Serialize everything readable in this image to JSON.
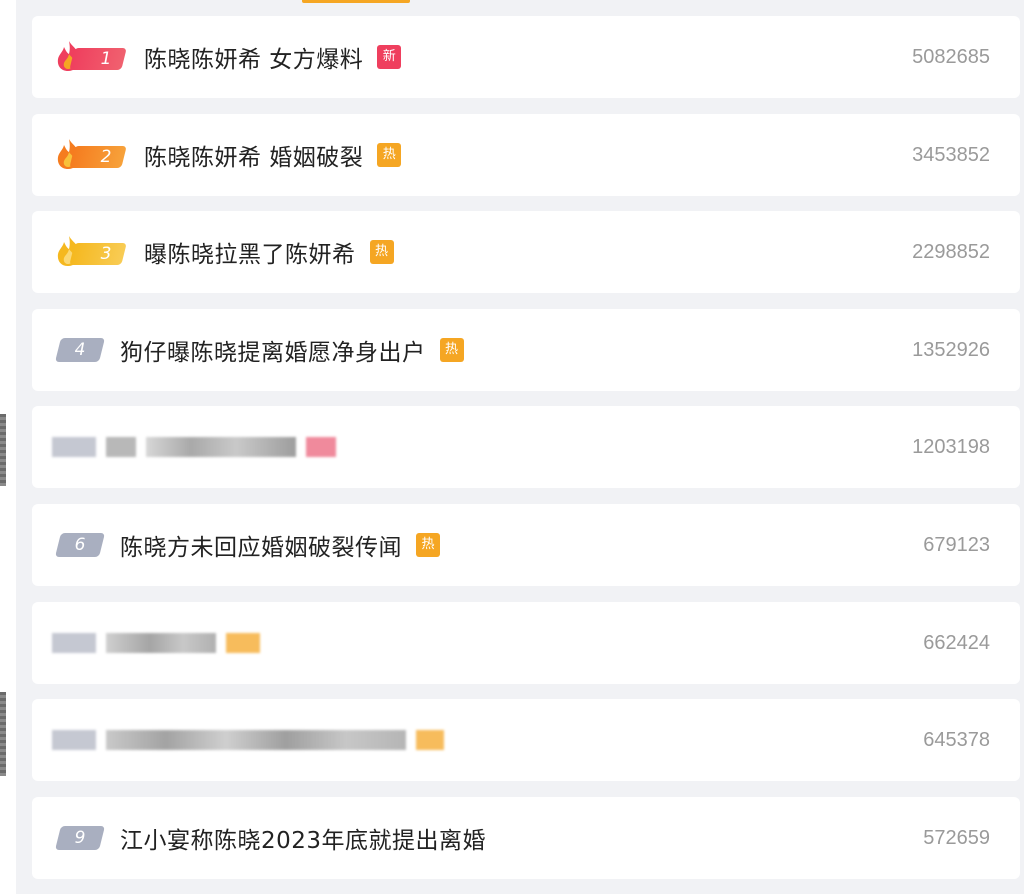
{
  "colors": {
    "rank1": "#ef3f5e",
    "rank2": "#f57c1f",
    "rank3": "#f5b81f",
    "rank_gray": "#a9afc0",
    "tag_new": "#ef3f5e",
    "tag_hot": "#f5a623",
    "count_text": "#9a9a9a"
  },
  "rows": [
    {
      "rank": "1",
      "title": "陈晓陈妍希 女方爆料",
      "tag": "新",
      "tag_type": "new",
      "count": "5082685",
      "icon": "flame-icon"
    },
    {
      "rank": "2",
      "title": "陈晓陈妍希 婚姻破裂",
      "tag": "热",
      "tag_type": "hot",
      "count": "3453852",
      "icon": "flame-icon"
    },
    {
      "rank": "3",
      "title": "曝陈晓拉黑了陈妍希",
      "tag": "热",
      "tag_type": "hot",
      "count": "2298852",
      "icon": "flame-icon"
    },
    {
      "rank": "4",
      "title": "狗仔曝陈晓提离婚愿净身出户",
      "tag": "热",
      "tag_type": "hot",
      "count": "1352926"
    },
    {
      "count": "1203198",
      "blurred": true
    },
    {
      "rank": "6",
      "title": "陈晓方未回应婚姻破裂传闻",
      "tag": "热",
      "tag_type": "hot",
      "count": "679123"
    },
    {
      "count": "662424",
      "blurred": true
    },
    {
      "count": "645378",
      "blurred": true
    },
    {
      "rank": "9",
      "title": "江小宴称陈晓2023年底就提出离婚",
      "count": "572659"
    }
  ]
}
